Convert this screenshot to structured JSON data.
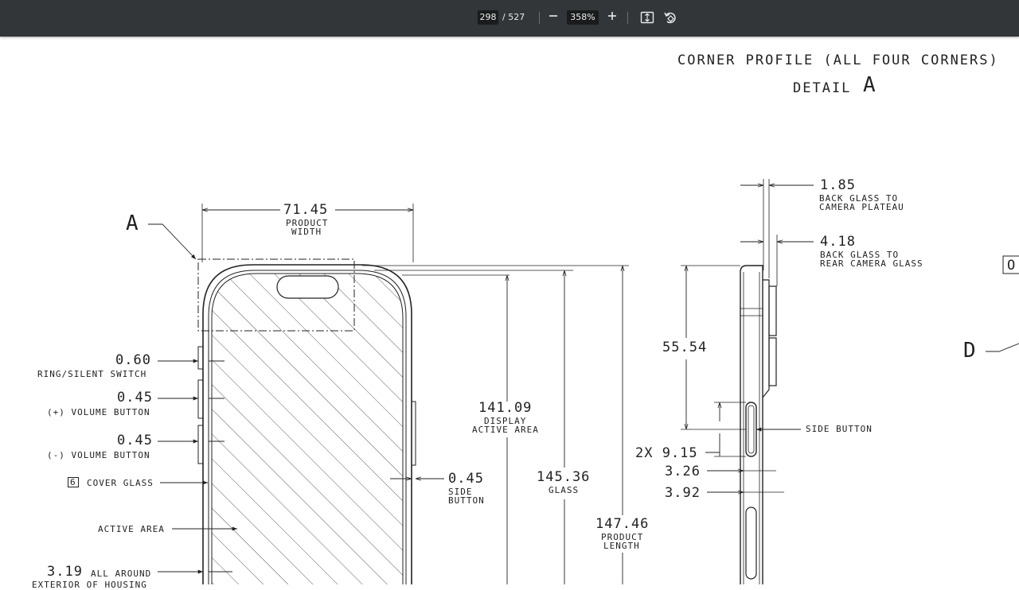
{
  "toolbar": {
    "current_page": "298",
    "total_pages": "/ 527",
    "zoom_out_icon": "minus-icon",
    "zoom": "358%",
    "zoom_in_icon": "plus-icon",
    "fit_icon": "fit-page-icon",
    "rotate_icon": "rotate-icon"
  },
  "drawing": {
    "corner_title": "CORNER PROFILE (ALL FOUR CORNERS)",
    "detail_label": "DETAIL",
    "detail_letter": "A",
    "marker_a": "A",
    "marker_d": "D",
    "marker_o": "O",
    "front": {
      "width_value": "71.45",
      "width_note_1": "PRODUCT",
      "width_note_2": "WIDTH",
      "ring_value": "0.60",
      "ring_note": "RING/SILENT SWITCH",
      "volup_value": "0.45",
      "volup_note": "(+) VOLUME BUTTON",
      "voldn_value": "0.45",
      "voldn_note": "(-) VOLUME BUTTON",
      "cover_num": "6",
      "cover_note": "COVER GLASS",
      "active_note": "ACTIVE AREA",
      "exterior_value": "3.19",
      "exterior_note_1": "ALL AROUND",
      "exterior_note_2": "EXTERIOR OF HOUSING",
      "display_value": "141.09",
      "display_note_1": "DISPLAY",
      "display_note_2": "ACTIVE AREA",
      "side_value": "0.45",
      "side_note_1": "SIDE",
      "side_note_2": "BUTTON",
      "glass_value": "145.36",
      "glass_note": "GLASS",
      "length_value": "147.46",
      "length_note_1": "PRODUCT",
      "length_note_2": "LENGTH"
    },
    "side": {
      "plateau_value": "1.85",
      "plateau_note_1": "BACK GLASS TO",
      "plateau_note_2": "CAMERA PLATEAU",
      "rear_value": "4.18",
      "rear_note_1": "BACK GLASS TO",
      "rear_note_2": "REAR CAMERA GLASS",
      "height_value": "55.54",
      "side_button_note": "SIDE BUTTON",
      "button_len_value": "2X 9.15",
      "dim1_value": "3.26",
      "dim2_value": "3.92"
    }
  }
}
